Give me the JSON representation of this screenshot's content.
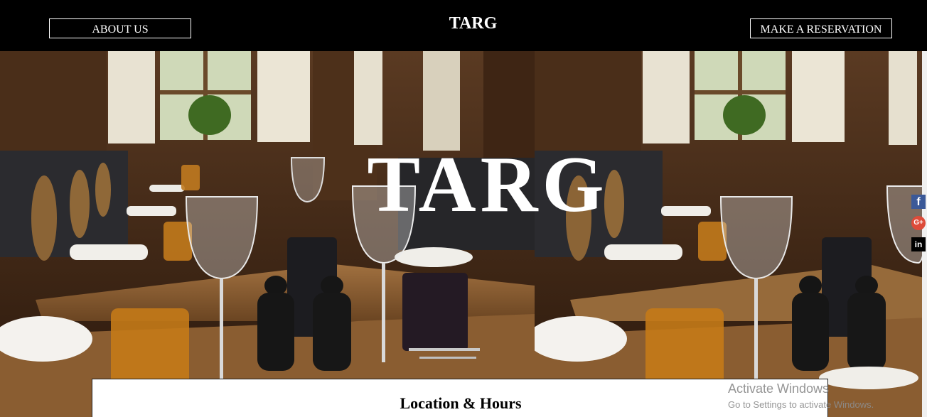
{
  "header": {
    "about_label": "ABOUT US",
    "brand": "TARG",
    "reserve_label": "MAKE A RESERVATION"
  },
  "hero": {
    "title": "TARG"
  },
  "social": {
    "facebook": "f",
    "googleplus": "G+",
    "linkedin": "in"
  },
  "location": {
    "title": "Location & Hours"
  },
  "watermark": {
    "title": "Activate Windows",
    "subtitle": "Go to Settings to activate Windows."
  },
  "colors": {
    "topbar": "#000000",
    "facebook": "#3b5998",
    "googleplus": "#dd4b39",
    "linkedin": "#000000"
  }
}
